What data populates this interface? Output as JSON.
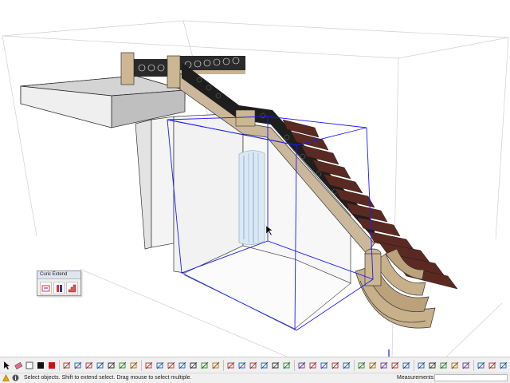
{
  "panel": {
    "title": "Curic Extend",
    "tools": [
      "extend-tool-icon",
      "extend-face-icon",
      "extend-stair-icon"
    ]
  },
  "toolbar": {
    "icons": [
      "select-arrow-icon",
      "eraser-icon",
      "color-rect-white-icon",
      "color-rect-black-icon",
      "color-rect-red-icon",
      "sep",
      "paint-bucket-icon",
      "move-icon",
      "rotate-icon",
      "scale-icon",
      "push-pull-icon",
      "follow-me-icon",
      "offset-icon",
      "sep",
      "line-icon",
      "rectangle-icon",
      "rotated-rect-icon",
      "circle-icon",
      "polygon-icon",
      "arc-icon",
      "freehand-icon",
      "sep",
      "tape-measure-icon",
      "dimension-icon",
      "protractor-icon",
      "text-icon",
      "axes-icon",
      "3d-text-icon",
      "sep",
      "section-plane-icon",
      "iso-view-icon",
      "top-view-icon",
      "front-view-icon",
      "right-view-icon",
      "sep",
      "orbit-icon",
      "pan-icon",
      "zoom-icon",
      "zoom-extents-icon",
      "previous-view-icon",
      "sep",
      "walk-icon",
      "look-around-icon",
      "position-camera-icon",
      "sandbox-icon",
      "flip-icon",
      "sep",
      "component-icon",
      "group-icon",
      "layer-icon",
      "materials-icon",
      "styles-icon",
      "scenes-icon",
      "shadows-icon",
      "fog-icon",
      "xray-icon",
      "wireframe-icon"
    ]
  },
  "status": {
    "icons": [
      "warning-icon",
      "info-icon"
    ],
    "text": "Select objects. Shift to extend select. Drag mouse to select multiple.",
    "measurements_label": "Measurements",
    "measurements_value": ""
  },
  "colors": {
    "selection_box": "#1a1aff",
    "stair_wood": "#5a2a22",
    "stone": "#cbb89a",
    "railing": "#1e1e1e",
    "toolbar_bg": "#f0f0f0"
  }
}
